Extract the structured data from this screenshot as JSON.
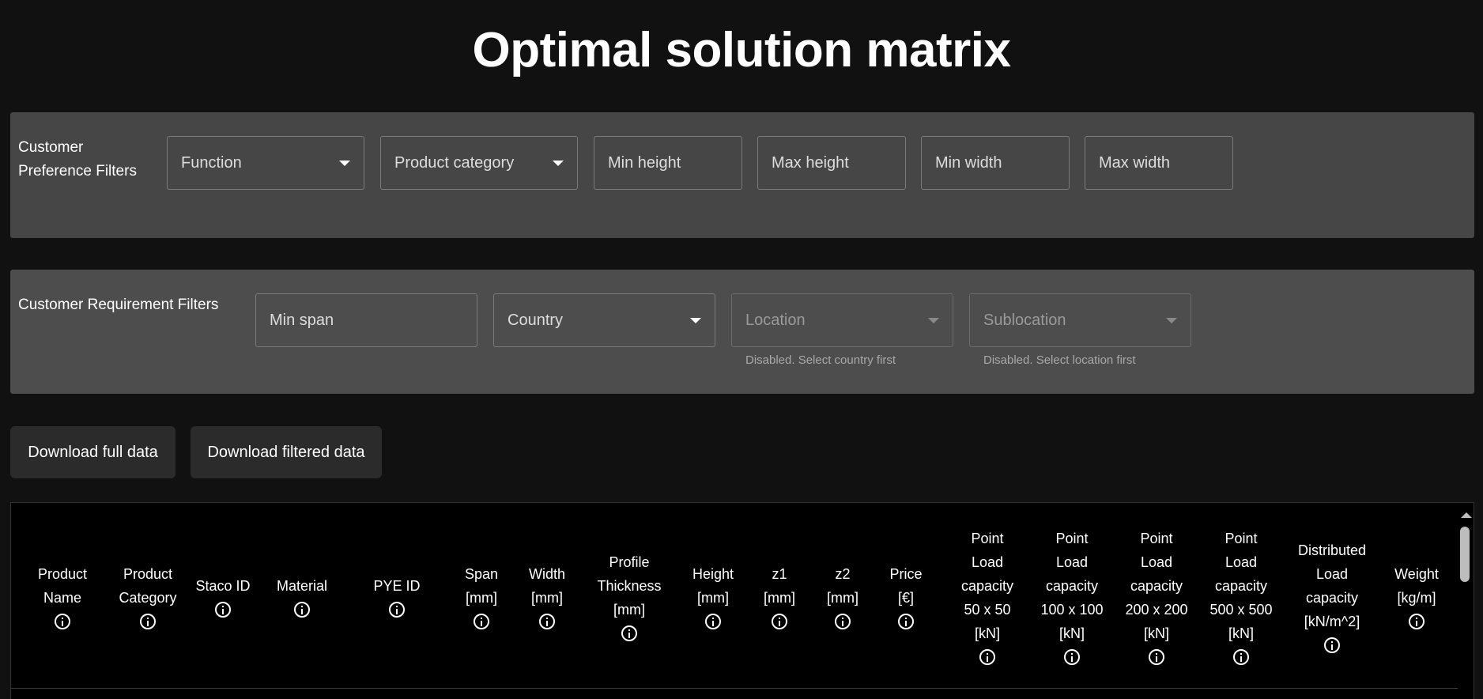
{
  "page_title": "Optimal solution matrix",
  "preference_filters": {
    "label": "Customer Preference Filters",
    "function": "Function",
    "product_category": "Product category",
    "min_height": "Min height",
    "max_height": "Max height",
    "min_width": "Min width",
    "max_width": "Max width"
  },
  "requirement_filters": {
    "label": "Customer Requirement Filters",
    "min_span": "Min span",
    "country": "Country",
    "location": "Location",
    "location_helper": "Disabled. Select country first",
    "sublocation": "Sublocation",
    "sublocation_helper": "Disabled. Select location first"
  },
  "buttons": {
    "download_full": "Download full data",
    "download_filtered": "Download filtered data"
  },
  "table": {
    "columns": [
      "Product Name",
      "Product Category",
      "Staco ID",
      "Material",
      "PYE ID",
      "Span [mm]",
      "Width [mm]",
      "Profile Thickness [mm]",
      "Height [mm]",
      "z1 [mm]",
      "z2 [mm]",
      "Price [€]",
      "Point Load capacity 50 x 50 [kN]",
      "Point Load capacity 100 x 100 [kN]",
      "Point Load capacity 200 x 200 [kN]",
      "Point Load capacity 500 x 500 [kN]",
      "Distributed Load capacity [kN/m^2]",
      "Weight [kg/m]"
    ]
  }
}
